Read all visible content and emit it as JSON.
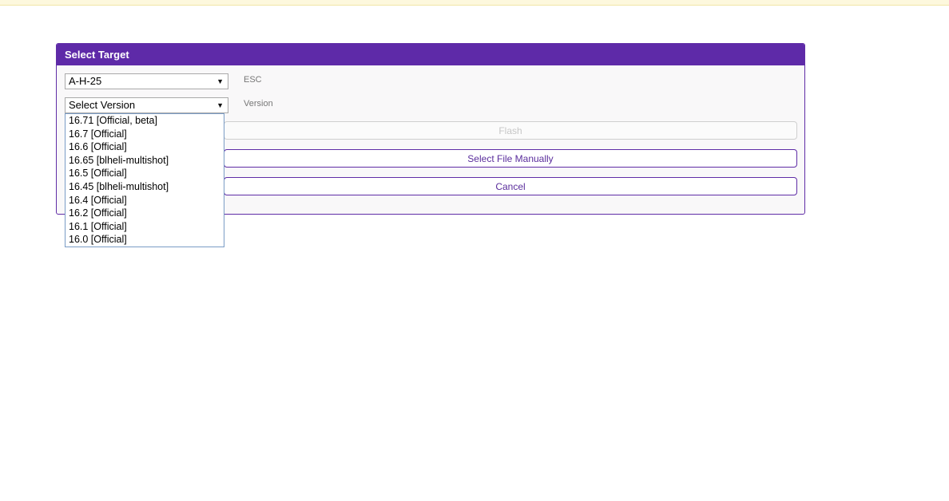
{
  "panel": {
    "title": "Select Target"
  },
  "esc_select": {
    "value": "A-H-25",
    "label": "ESC"
  },
  "version_select": {
    "value": "Select Version",
    "label": "Version",
    "options": [
      "16.71 [Official, beta]",
      "16.7 [Official]",
      "16.6 [Official]",
      "16.65 [blheli-multishot]",
      "16.5 [Official]",
      "16.45 [blheli-multishot]",
      "16.4 [Official]",
      "16.2 [Official]",
      "16.1 [Official]",
      "16.0 [Official]"
    ]
  },
  "buttons": {
    "flash": "Flash",
    "select_file": "Select File Manually",
    "cancel": "Cancel"
  },
  "colors": {
    "accent": "#5e2aa8",
    "notice_strip": "#fdf8dd"
  },
  "icons": {
    "dropdown_arrow": "▼"
  }
}
